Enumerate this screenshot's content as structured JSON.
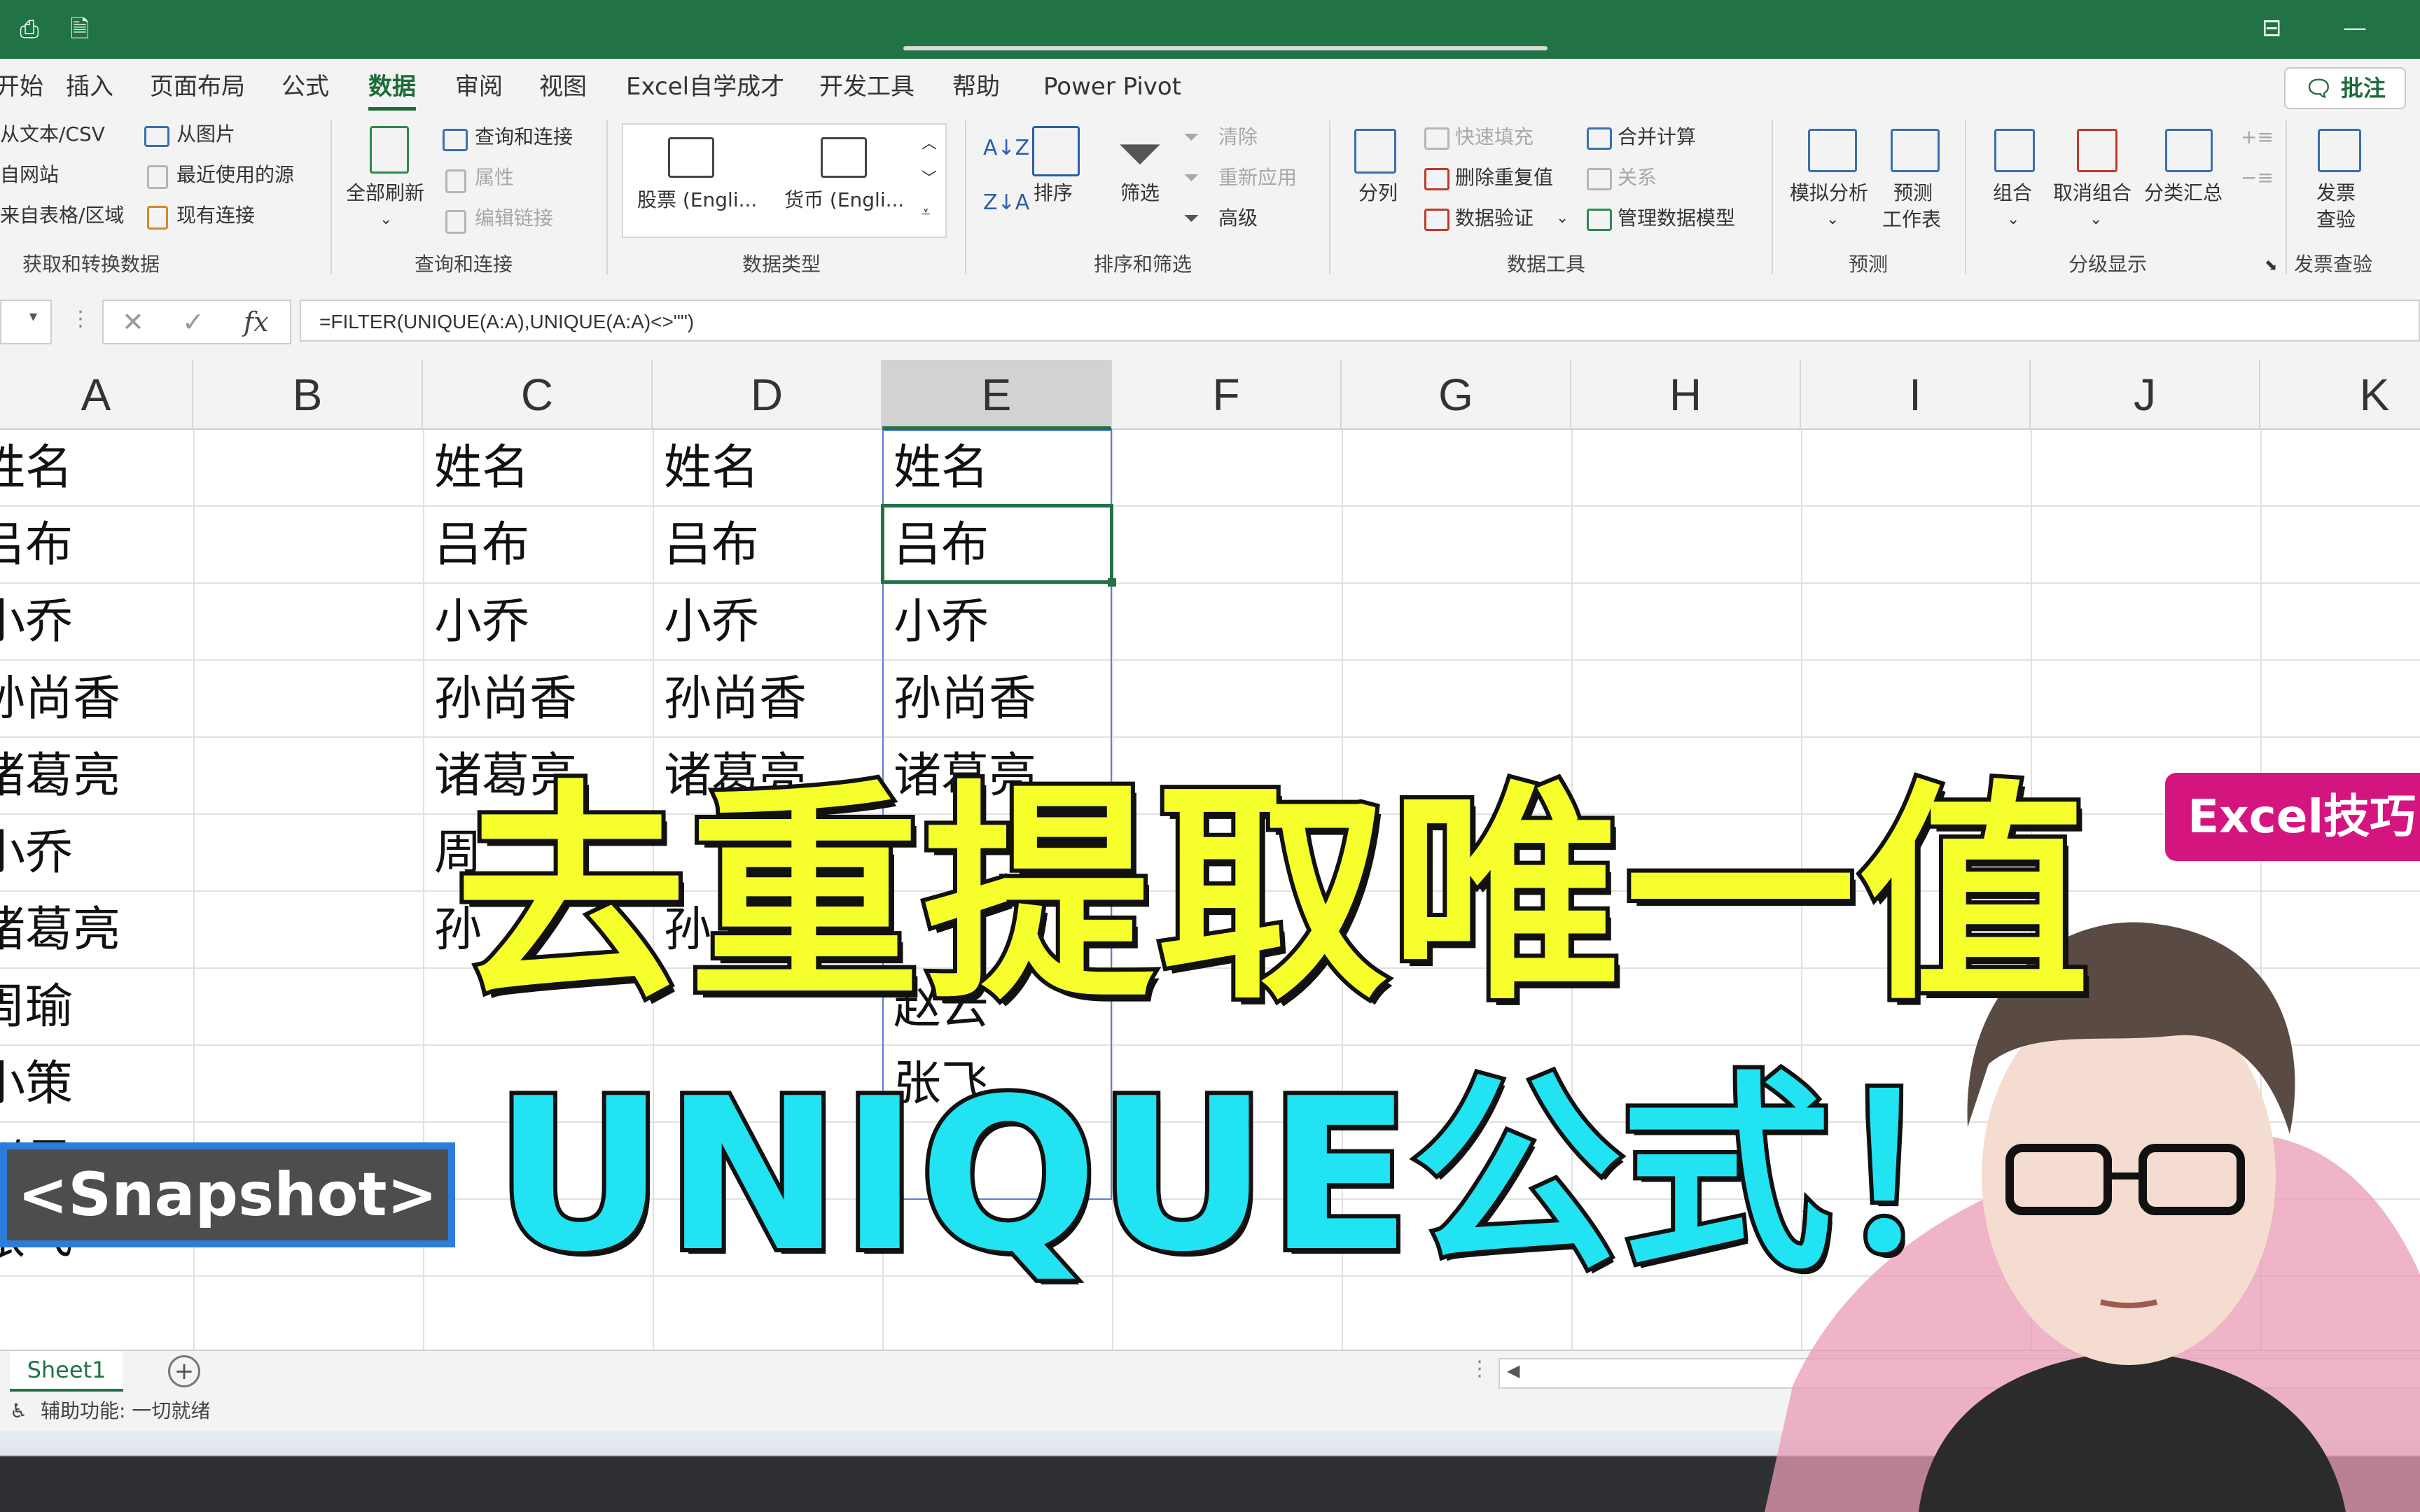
{
  "app": {
    "accent": "#217346"
  },
  "quick_access": [
    "save-icon",
    "preview-icon"
  ],
  "menu": {
    "tabs": [
      "开始",
      "插入",
      "页面布局",
      "公式",
      "数据",
      "审阅",
      "视图",
      "Excel自学成才",
      "开发工具",
      "帮助",
      "Power Pivot"
    ],
    "active_index": 4,
    "comment_label": "批注"
  },
  "ribbon": {
    "get_transform": {
      "items": [
        "从文本/CSV",
        "自网站",
        "来自表格/区域",
        "从图片",
        "最近使用的源",
        "现有连接"
      ],
      "group_label": "获取和转换数据"
    },
    "queries": {
      "refresh_all": "全部刷新",
      "items": [
        "查询和连接",
        "属性",
        "编辑链接"
      ],
      "group_label": "查询和连接"
    },
    "data_types": {
      "items": [
        "股票 (Engli...",
        "货币 (Engli..."
      ],
      "group_label": "数据类型"
    },
    "sort_filter": {
      "sort": "排序",
      "filter": "筛选",
      "items": [
        "清除",
        "重新应用",
        "高级"
      ],
      "group_label": "排序和筛选"
    },
    "data_tools": {
      "split": "分列",
      "items": [
        "快速填充",
        "删除重复值",
        "数据验证",
        "合并计算",
        "关系",
        "管理数据模型"
      ],
      "group_label": "数据工具"
    },
    "forecast": {
      "whatif": "模拟分析",
      "sheet_a": "预测",
      "sheet_b": "工作表",
      "group_label": "预测"
    },
    "outline": {
      "items": [
        "组合",
        "取消组合",
        "分类汇总"
      ],
      "group_label": "分级显示"
    },
    "invoice": {
      "a": "发票",
      "b": "查验",
      "group_label": "发票查验"
    }
  },
  "formula_bar": {
    "fx": "fx",
    "formula": "=FILTER(UNIQUE(A:A),UNIQUE(A:A)<>\"\")"
  },
  "columns": [
    "A",
    "B",
    "C",
    "D",
    "E",
    "F",
    "G",
    "H",
    "I",
    "J",
    "K"
  ],
  "selected_column": "E",
  "cells": {
    "A": [
      "姓名",
      "吕布",
      "小乔",
      "孙尚香",
      "诸葛亮",
      "小乔",
      "诸葛亮",
      "周瑜",
      "小策",
      "赵云",
      "张飞"
    ],
    "C": [
      "姓名",
      "吕布",
      "小乔",
      "孙尚香",
      "诸葛亮",
      "周",
      "孙"
    ],
    "D": [
      "姓名",
      "吕布",
      "小乔",
      "孙尚香",
      "诸葛亮",
      "",
      "孙"
    ],
    "E": [
      "姓名",
      "吕布",
      "小乔",
      "孙尚香",
      "诸葛亮",
      "",
      "",
      "赵云",
      "张飞"
    ]
  },
  "sheets": [
    "Sheet1"
  ],
  "status": "辅助功能: 一切就绪",
  "overlay": {
    "title": "去重提取唯一值",
    "subtitle": "UNIQUE公式！",
    "snapshot": "<Snapshot>",
    "badge": "Excel技巧"
  }
}
